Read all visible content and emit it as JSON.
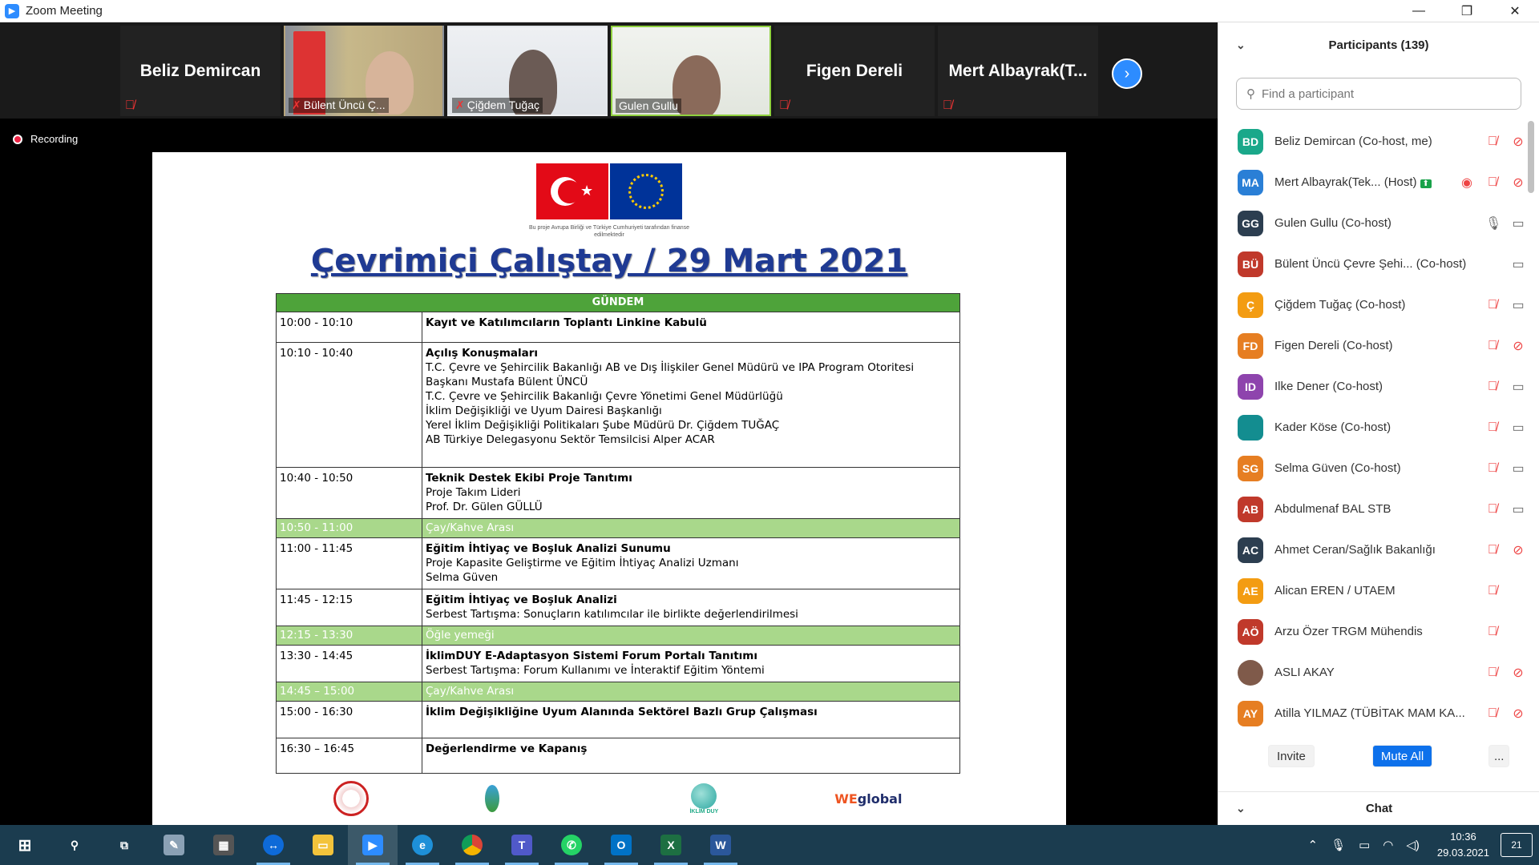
{
  "window": {
    "title": "Zoom Meeting"
  },
  "video_strip": {
    "tiles": [
      {
        "name": "Beliz Demircan",
        "type": "name"
      },
      {
        "name": "Bülent Üncü Ç...",
        "type": "video"
      },
      {
        "name": "Çiğdem Tuğaç",
        "type": "video"
      },
      {
        "name": "Gulen Gullu",
        "type": "video"
      },
      {
        "name": "Figen Dereli",
        "type": "name"
      },
      {
        "name": "Mert Albayrak(T...",
        "type": "name"
      }
    ]
  },
  "recording_label": "Recording",
  "slide": {
    "flag_caption": "Bu proje Avrupa Birliği ve Türkiye Cumhuriyeti tarafından finanse edilmektedir",
    "title": "Çevrimiçi Çalıştay / 29 Mart 2021",
    "agenda_header": "GÜNDEM",
    "agenda": [
      {
        "time": "10:00 - 10:10",
        "bold": "Kayıt ve Katılımcıların Toplantı Linkine Kabulü",
        "lines": [],
        "break": false
      },
      {
        "time": "10:10 - 10:40",
        "bold": "Açılış Konuşmaları",
        "lines": [
          "T.C. Çevre ve Şehircilik Bakanlığı AB ve Dış İlişkiler Genel Müdürü ve IPA Program Otoritesi",
          "Başkanı Mustafa Bülent ÜNCÜ",
          "T.C. Çevre ve Şehircilik Bakanlığı Çevre Yönetimi Genel Müdürlüğü",
          "İklim Değişikliği ve Uyum Dairesi Başkanlığı",
          "Yerel İklim Değişikliği Politikaları Şube Müdürü Dr. Çiğdem TUĞAÇ",
          "AB Türkiye Delegasyonu Sektör Temsilcisi Alper ACAR"
        ],
        "break": false
      },
      {
        "time": "10:40 - 10:50",
        "bold": "Teknik Destek Ekibi Proje Tanıtımı",
        "lines": [
          "Proje Takım Lideri",
          "Prof. Dr. Gülen GÜLLÜ"
        ],
        "break": false
      },
      {
        "time": "10:50 - 11:00",
        "bold": "",
        "lines": [
          "Çay/Kahve Arası"
        ],
        "break": true
      },
      {
        "time": "11:00 - 11:45",
        "bold": "Eğitim İhtiyaç ve Boşluk Analizi Sunumu",
        "lines": [
          "Proje Kapasite Geliştirme ve Eğitim İhtiyaç Analizi Uzmanı",
          "Selma Güven"
        ],
        "break": false
      },
      {
        "time": "11:45 - 12:15",
        "bold": "Eğitim İhtiyaç ve Boşluk Analizi",
        "lines": [
          "Serbest Tartışma: Sonuçların katılımcılar ile birlikte değerlendirilmesi"
        ],
        "break": false
      },
      {
        "time": "12:15 - 13:30",
        "bold": "",
        "lines": [
          "Öğle yemeği"
        ],
        "break": true
      },
      {
        "time": "13:30 - 14:45",
        "bold": "İklimDUY E-Adaptasyon Sistemi Forum Portalı Tanıtımı",
        "lines": [
          "Serbest Tartışma: Forum Kullanımı ve İnteraktif Eğitim Yöntemi"
        ],
        "break": false
      },
      {
        "time": "14:45 – 15:00",
        "bold": "",
        "lines": [
          "Çay/Kahve Arası"
        ],
        "break": true
      },
      {
        "time": "15:00 - 16:30",
        "bold": "İklim Değişikliğine Uyum Alanında Sektörel Bazlı Grup Çalışması",
        "lines": [],
        "break": false
      },
      {
        "time": "16:30 – 16:45",
        "bold": "Değerlendirme ve Kapanış",
        "lines": [],
        "break": false
      }
    ],
    "logos": {
      "iklim": "İKLİM DUY",
      "we_prefix": "WE",
      "we_suffix": "global"
    }
  },
  "participants": {
    "header": "Participants (139)",
    "search_placeholder": "Find a participant",
    "list": [
      {
        "initials": "BD",
        "name": "Beliz Demircan (Co-host, me)",
        "color": "#1aa88a",
        "mic": "muted",
        "cam": "off"
      },
      {
        "initials": "MA",
        "name": "Mert Albayrak(Tek... (Host)",
        "color": "#2a7fd6",
        "mic": "muted",
        "cam": "off",
        "badge": "share",
        "rec": true
      },
      {
        "initials": "GG",
        "name": "Gulen Gullu (Co-host)",
        "color": "#2c3e50",
        "mic": "on",
        "cam": "on"
      },
      {
        "initials": "BÜ",
        "name": "Bülent Üncü Çevre Şehi... (Co-host)",
        "color": "#c0392b",
        "mic": "none",
        "cam": "on"
      },
      {
        "initials": "Ç",
        "name": "Çiğdem Tuğaç (Co-host)",
        "color": "#f39c12",
        "mic": "muted",
        "cam": "on"
      },
      {
        "initials": "FD",
        "name": "Figen Dereli (Co-host)",
        "color": "#e67e22",
        "mic": "muted",
        "cam": "off"
      },
      {
        "initials": "ID",
        "name": "Ilke Dener (Co-host)",
        "color": "#8e44ad",
        "mic": "muted",
        "cam": "on"
      },
      {
        "initials": "",
        "name": "Kader Köse (Co-host)",
        "color": "#138d90",
        "mic": "muted",
        "cam": "on"
      },
      {
        "initials": "SG",
        "name": "Selma Güven (Co-host)",
        "color": "#e67e22",
        "mic": "muted",
        "cam": "on"
      },
      {
        "initials": "AB",
        "name": "Abdulmenaf BAL STB",
        "color": "#c0392b",
        "mic": "muted",
        "cam": "on"
      },
      {
        "initials": "AC",
        "name": "Ahmet Ceran/Sağlık Bakanlığı",
        "color": "#2c3e50",
        "mic": "muted",
        "cam": "off"
      },
      {
        "initials": "AE",
        "name": "Alican EREN / UTAEM",
        "color": "#f39c12",
        "mic": "muted",
        "cam": "none"
      },
      {
        "initials": "AÖ",
        "name": "Arzu Özer TRGM Mühendis",
        "color": "#c0392b",
        "mic": "muted",
        "cam": "none"
      },
      {
        "initials": "",
        "name": "ASLI AKAY",
        "color": "#7f5a4a",
        "mic": "muted",
        "cam": "off",
        "photo": true
      },
      {
        "initials": "AY",
        "name": "Atilla YILMAZ (TÜBİTAK MAM KA...",
        "color": "#e67e22",
        "mic": "muted",
        "cam": "off"
      }
    ],
    "buttons": {
      "invite": "Invite",
      "mute_all": "Mute All",
      "more": "..."
    }
  },
  "chat": {
    "header": "Chat"
  },
  "taskbar": {
    "time": "10:36",
    "date": "29.03.2021",
    "notifications": "21"
  }
}
